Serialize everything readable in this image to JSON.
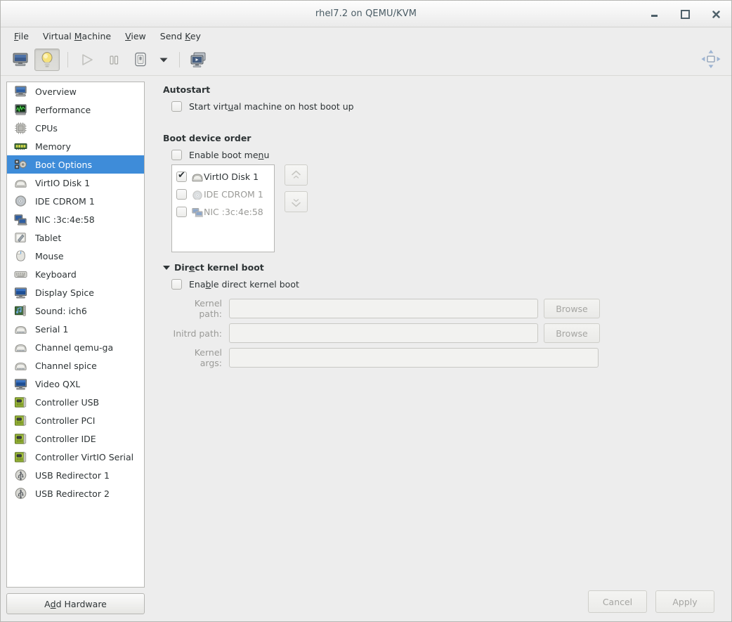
{
  "window": {
    "title": "rhel7.2 on QEMU/KVM",
    "minimize_label": "–",
    "maximize_label": "▫",
    "close_label": "✖"
  },
  "menubar": {
    "items": [
      {
        "pre": "",
        "key": "F",
        "post": "ile",
        "name": "menu-file"
      },
      {
        "pre": "Virtual ",
        "key": "M",
        "post": "achine",
        "name": "menu-virtual-machine"
      },
      {
        "pre": "",
        "key": "V",
        "post": "iew",
        "name": "menu-view"
      },
      {
        "pre": "Send ",
        "key": "K",
        "post": "ey",
        "name": "menu-send-key"
      }
    ]
  },
  "toolbar": {
    "buttons": [
      {
        "icon": "console-monitor-icon",
        "name": "show-console-button",
        "pressed": false,
        "enabled": true
      },
      {
        "icon": "lightbulb-details-icon",
        "name": "show-details-button",
        "pressed": true,
        "enabled": true
      },
      {
        "icon": "play-icon",
        "name": "run-button",
        "pressed": false,
        "enabled": false
      },
      {
        "icon": "pause-icon",
        "name": "pause-button",
        "pressed": false,
        "enabled": true
      },
      {
        "icon": "shutdown-icon",
        "name": "shutdown-button",
        "pressed": false,
        "enabled": true
      }
    ],
    "dropdown_icon": "chevron-down-icon",
    "snapshots_icon": "snapshots-icon",
    "fullscreen_icon": "fullscreen-expand-icon"
  },
  "sidebar": {
    "items": [
      {
        "label": "Overview",
        "icon": "monitor-icon",
        "selected": false
      },
      {
        "label": "Performance",
        "icon": "performance-graph-icon",
        "selected": false
      },
      {
        "label": "CPUs",
        "icon": "cpu-chip-icon",
        "selected": false
      },
      {
        "label": "Memory",
        "icon": "memory-stick-icon",
        "selected": false
      },
      {
        "label": "Boot Options",
        "icon": "boot-options-icon",
        "selected": true
      },
      {
        "label": "VirtIO Disk 1",
        "icon": "harddisk-icon",
        "selected": false
      },
      {
        "label": "IDE CDROM 1",
        "icon": "cdrom-icon",
        "selected": false
      },
      {
        "label": "NIC :3c:4e:58",
        "icon": "network-icon",
        "selected": false
      },
      {
        "label": "Tablet",
        "icon": "tablet-icon",
        "selected": false
      },
      {
        "label": "Mouse",
        "icon": "mouse-icon",
        "selected": false
      },
      {
        "label": "Keyboard",
        "icon": "keyboard-icon",
        "selected": false
      },
      {
        "label": "Display Spice",
        "icon": "display-icon",
        "selected": false
      },
      {
        "label": "Sound: ich6",
        "icon": "sound-icon",
        "selected": false
      },
      {
        "label": "Serial 1",
        "icon": "serial-icon",
        "selected": false
      },
      {
        "label": "Channel qemu-ga",
        "icon": "serial-icon",
        "selected": false
      },
      {
        "label": "Channel spice",
        "icon": "serial-icon",
        "selected": false
      },
      {
        "label": "Video QXL",
        "icon": "display-icon",
        "selected": false
      },
      {
        "label": "Controller USB",
        "icon": "controller-card-icon",
        "selected": false
      },
      {
        "label": "Controller PCI",
        "icon": "controller-card-icon",
        "selected": false
      },
      {
        "label": "Controller IDE",
        "icon": "controller-card-icon",
        "selected": false
      },
      {
        "label": "Controller VirtIO Serial",
        "icon": "controller-card-icon",
        "selected": false
      },
      {
        "label": "USB Redirector 1",
        "icon": "usb-icon",
        "selected": false
      },
      {
        "label": "USB Redirector 2",
        "icon": "usb-icon",
        "selected": false
      }
    ],
    "add_hardware": {
      "pre": "A",
      "key": "d",
      "post": "d Hardware"
    }
  },
  "main": {
    "autostart": {
      "heading": "Autostart",
      "checkbox": {
        "pre": "Start virt",
        "key": "u",
        "post": "al machine on host boot up",
        "checked": false
      }
    },
    "boot_order": {
      "heading": "Boot device order",
      "enable_boot_menu": {
        "pre": "Enable boot me",
        "key": "n",
        "post": "u",
        "checked": false
      },
      "devices": [
        {
          "label": "VirtIO Disk 1",
          "icon": "harddisk-small-icon",
          "checked": true,
          "enabled": true
        },
        {
          "label": "IDE CDROM 1",
          "icon": "cdrom-small-icon",
          "checked": false,
          "enabled": false
        },
        {
          "label": "NIC :3c:4e:58",
          "icon": "network-small-icon",
          "checked": false,
          "enabled": false
        }
      ],
      "move_up_icon": "double-chevron-up-icon",
      "move_down_icon": "double-chevron-down-icon"
    },
    "direct_kernel": {
      "heading": {
        "pre": "Dir",
        "key": "e",
        "post": "ct kernel boot"
      },
      "expanded": true,
      "enable_checkbox": {
        "pre": "Ena",
        "key": "b",
        "post": "le direct kernel boot",
        "checked": false
      },
      "fields": [
        {
          "label": "Kernel path:",
          "value": "",
          "browse": "Browse",
          "name": "kernel-path"
        },
        {
          "label": "Initrd path:",
          "value": "",
          "browse": "Browse",
          "name": "initrd-path"
        },
        {
          "label": "Kernel args:",
          "value": "",
          "browse": null,
          "name": "kernel-args"
        }
      ]
    }
  },
  "footer": {
    "cancel_label": "Cancel",
    "apply_label": "Apply"
  },
  "colors": {
    "selection_blue": "#3e8cd9",
    "window_bg": "#ededed",
    "list_bg": "#ffffff",
    "disabled_text": "#9a9a97"
  }
}
